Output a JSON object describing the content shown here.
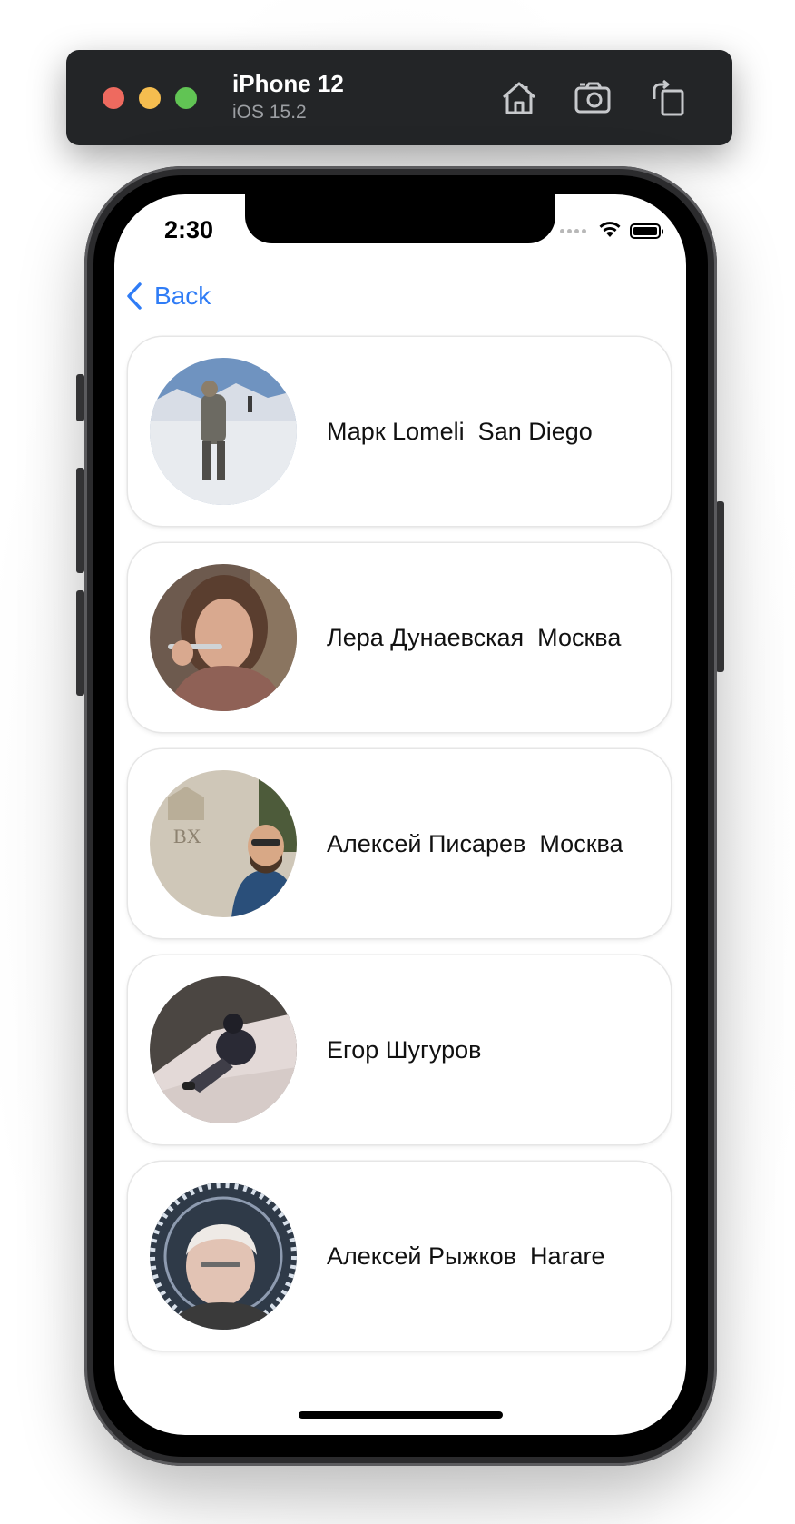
{
  "simulator": {
    "device_name": "iPhone 12",
    "os_version": "iOS 15.2",
    "icons": [
      "home-icon",
      "screenshot-icon",
      "rotate-icon"
    ]
  },
  "status_bar": {
    "time": "2:30"
  },
  "nav": {
    "back_label": "Back",
    "accent_color": "#2f7cf6"
  },
  "people": [
    {
      "name": "Марк Lomeli",
      "city": "San Diego",
      "label": "Марк Lomeli  San Diego"
    },
    {
      "name": "Лера Дунаевская",
      "city": "Москва",
      "label": "Лера Дунаевская  Москва"
    },
    {
      "name": "Алексей Писарев",
      "city": "Москва",
      "label": "Алексей Писарев  Москва"
    },
    {
      "name": "Егор Шугуров",
      "city": "",
      "label": "Егор Шугуров"
    },
    {
      "name": "Алексей Рыжков",
      "city": "Harare",
      "label": "Алексей Рыжков  Harare"
    }
  ]
}
